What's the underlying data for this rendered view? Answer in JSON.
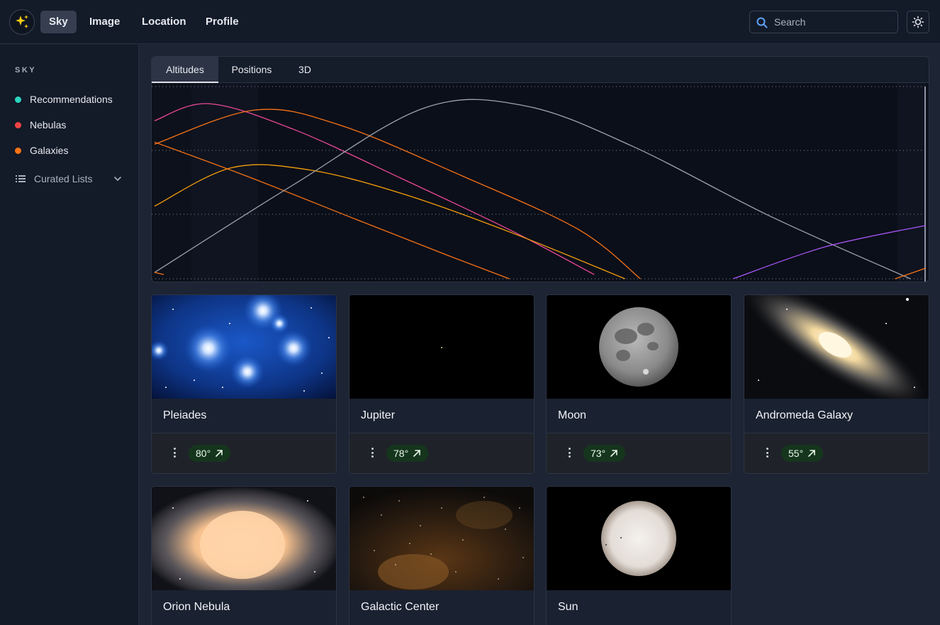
{
  "header": {
    "nav": [
      "Sky",
      "Image",
      "Location",
      "Profile"
    ],
    "active_nav": "Sky",
    "search": {
      "placeholder": "Search",
      "value": ""
    },
    "logo_icon": "sparkles-icon",
    "theme_icon": "sun-icon"
  },
  "sidebar": {
    "heading": "SKY",
    "items": [
      {
        "label": "Recommendations",
        "color": "#2dd4bf"
      },
      {
        "label": "Nebulas",
        "color": "#ef4444"
      },
      {
        "label": "Galaxies",
        "color": "#f97316"
      }
    ],
    "curated": {
      "label": "Curated Lists",
      "icon": "list-icon",
      "chevron": "chevron-down-icon"
    }
  },
  "tabs": [
    "Altitudes",
    "Positions",
    "3D"
  ],
  "active_tab": "Altitudes",
  "chart_data": {
    "type": "line",
    "title": "",
    "xlabel": "",
    "ylabel": "",
    "grid": "dotted horizontal",
    "series": [
      {
        "color": "#ec4899",
        "x": [
          0,
          7,
          18,
          32,
          46,
          57
        ],
        "y": [
          74,
          82,
          70,
          47,
          23,
          2
        ]
      },
      {
        "color": "#f97316",
        "x": [
          0,
          13,
          24,
          40,
          55,
          63
        ],
        "y": [
          63,
          79,
          72,
          48,
          23,
          0
        ]
      },
      {
        "color": "#f59e0b",
        "x": [
          0,
          10,
          20,
          32,
          46,
          61
        ],
        "y": [
          34,
          52,
          51,
          40,
          22,
          0
        ]
      },
      {
        "color": "#f97316",
        "x": [
          0,
          12,
          26,
          38,
          46
        ],
        "y": [
          64,
          48,
          28,
          11,
          0
        ]
      },
      {
        "color": "#9ca3af",
        "x": [
          0,
          18,
          35,
          48,
          62,
          80,
          98
        ],
        "y": [
          3,
          44,
          80,
          81,
          62,
          29,
          0
        ]
      },
      {
        "color": "#a855f7",
        "x": [
          75,
          87,
          100
        ],
        "y": [
          0,
          15,
          25
        ]
      },
      {
        "color": "#f97316",
        "x": [
          96,
          100
        ],
        "y": [
          0,
          5
        ]
      },
      {
        "color": "#f97316",
        "x": [
          0,
          1.2
        ],
        "y": [
          3,
          2
        ]
      }
    ]
  },
  "cards": [
    {
      "name": "Pleiades",
      "altitude": "80°",
      "image": "pleiades"
    },
    {
      "name": "Jupiter",
      "altitude": "78°",
      "image": "jupiter"
    },
    {
      "name": "Moon",
      "altitude": "73°",
      "image": "moon"
    },
    {
      "name": "Andromeda Galaxy",
      "altitude": "55°",
      "image": "andromeda"
    },
    {
      "name": "Orion Nebula",
      "image": "orion"
    },
    {
      "name": "Galactic Center",
      "image": "galactic-center"
    },
    {
      "name": "Sun",
      "image": "sun"
    }
  ]
}
